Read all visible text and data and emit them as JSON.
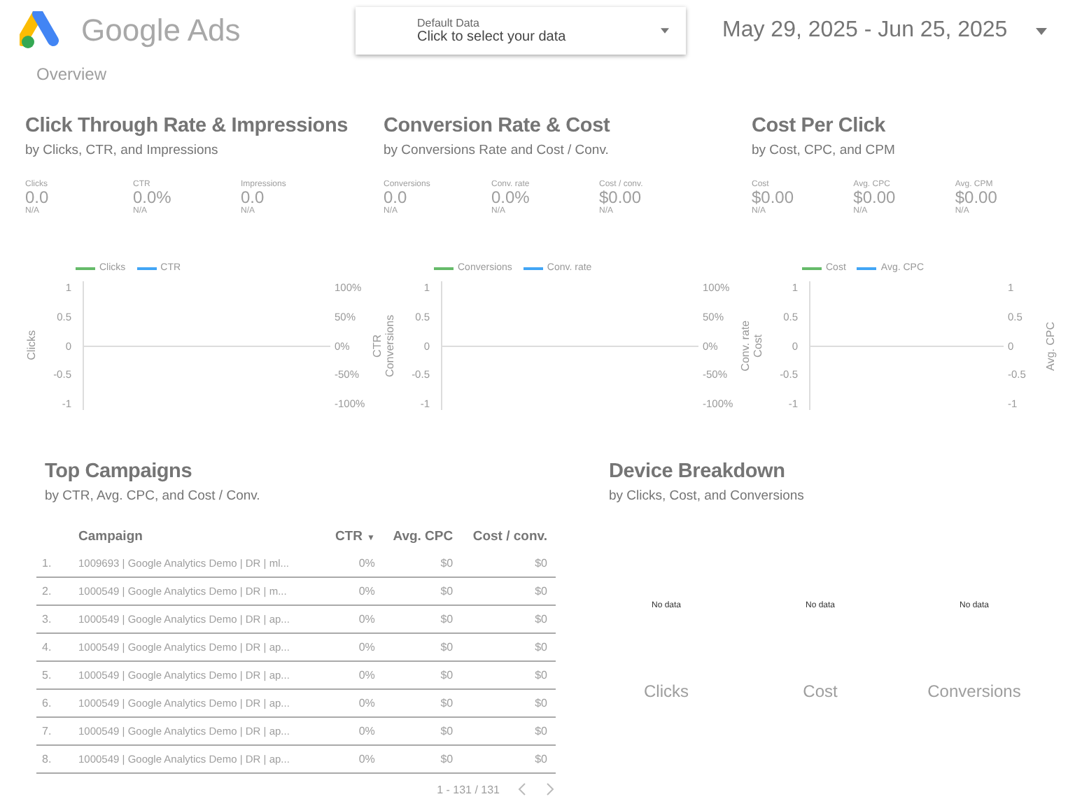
{
  "header": {
    "brand": "Google Ads",
    "data_source": {
      "label": "Default Data",
      "value": "Click to select your data"
    },
    "date_range": "May 29, 2025 - Jun 25, 2025"
  },
  "page_title": "Overview",
  "sections": [
    {
      "title": "Click Through Rate & Impressions",
      "subtitle": "by Clicks, CTR, and Impressions",
      "metrics": [
        {
          "label": "Clicks",
          "value": "0.0",
          "note": "N/A"
        },
        {
          "label": "CTR",
          "value": "0.0%",
          "note": "N/A"
        },
        {
          "label": "Impressions",
          "value": "0.0",
          "note": "N/A"
        }
      ],
      "chart": {
        "legend": [
          {
            "label": "Clicks",
            "color": "#66bb6a"
          },
          {
            "label": "CTR",
            "color": "#42a5f5"
          }
        ],
        "left_axis": {
          "title": "Clicks",
          "ticks": [
            "1",
            "0.5",
            "0",
            "-0.5",
            "-1"
          ]
        },
        "right_axis": {
          "title": "CTR",
          "ticks": [
            "100%",
            "50%",
            "0%",
            "-50%",
            "-100%"
          ]
        }
      }
    },
    {
      "title": "Conversion Rate & Cost",
      "subtitle": "by Conversions Rate and Cost / Conv.",
      "metrics": [
        {
          "label": "Conversions",
          "value": "0.0",
          "note": "N/A"
        },
        {
          "label": "Conv. rate",
          "value": "0.0%",
          "note": "N/A"
        },
        {
          "label": "Cost / conv.",
          "value": "$0.00",
          "note": "N/A"
        }
      ],
      "chart": {
        "legend": [
          {
            "label": "Conversions",
            "color": "#66bb6a"
          },
          {
            "label": "Conv. rate",
            "color": "#42a5f5"
          }
        ],
        "left_axis": {
          "title": "Conversions",
          "ticks": [
            "1",
            "0.5",
            "0",
            "-0.5",
            "-1"
          ]
        },
        "right_axis": {
          "title": "Conv. rate",
          "ticks": [
            "100%",
            "50%",
            "0%",
            "-50%",
            "-100%"
          ]
        }
      }
    },
    {
      "title": "Cost Per Click",
      "subtitle": "by Cost, CPC, and CPM",
      "metrics": [
        {
          "label": "Cost",
          "value": "$0.00",
          "note": "N/A"
        },
        {
          "label": "Avg. CPC",
          "value": "$0.00",
          "note": "N/A"
        },
        {
          "label": "Avg. CPM",
          "value": "$0.00",
          "note": "N/A"
        }
      ],
      "chart": {
        "legend": [
          {
            "label": "Cost",
            "color": "#66bb6a"
          },
          {
            "label": "Avg. CPC",
            "color": "#42a5f5"
          }
        ],
        "left_axis": {
          "title": "Cost",
          "ticks": [
            "1",
            "0.5",
            "0",
            "-0.5",
            "-1"
          ]
        },
        "right_axis": {
          "title": "Avg. CPC",
          "ticks": [
            "1",
            "0.5",
            "0",
            "-0.5",
            "-1"
          ]
        }
      }
    }
  ],
  "top_campaigns": {
    "title": "Top Campaigns",
    "subtitle": "by CTR, Avg. CPC, and Cost / Conv.",
    "columns": [
      {
        "label": "Campaign"
      },
      {
        "label": "CTR",
        "sort_indicator": "▼"
      },
      {
        "label": "Avg. CPC"
      },
      {
        "label": "Cost / conv."
      }
    ],
    "rows": [
      {
        "index": "1.",
        "campaign": "1009693 | Google Analytics Demo | DR | ml...",
        "ctr": "0%",
        "cpc": "$0",
        "cost_conv": "$0"
      },
      {
        "index": "2.",
        "campaign": "1000549 | Google Analytics Demo | DR | m...",
        "ctr": "0%",
        "cpc": "$0",
        "cost_conv": "$0"
      },
      {
        "index": "3.",
        "campaign": "1000549 | Google Analytics Demo | DR | ap...",
        "ctr": "0%",
        "cpc": "$0",
        "cost_conv": "$0"
      },
      {
        "index": "4.",
        "campaign": "1000549 | Google Analytics Demo | DR | ap...",
        "ctr": "0%",
        "cpc": "$0",
        "cost_conv": "$0"
      },
      {
        "index": "5.",
        "campaign": "1000549 | Google Analytics Demo | DR | ap...",
        "ctr": "0%",
        "cpc": "$0",
        "cost_conv": "$0"
      },
      {
        "index": "6.",
        "campaign": "1000549 | Google Analytics Demo | DR | ap...",
        "ctr": "0%",
        "cpc": "$0",
        "cost_conv": "$0"
      },
      {
        "index": "7.",
        "campaign": "1000549 | Google Analytics Demo | DR | ap...",
        "ctr": "0%",
        "cpc": "$0",
        "cost_conv": "$0"
      },
      {
        "index": "8.",
        "campaign": "1000549 | Google Analytics Demo | DR | ap...",
        "ctr": "0%",
        "cpc": "$0",
        "cost_conv": "$0"
      }
    ],
    "pagination": "1 - 131 / 131"
  },
  "device_breakdown": {
    "title": "Device Breakdown",
    "subtitle": "by Clicks, Cost, and Conversions",
    "panels": [
      {
        "message": "No data",
        "label": "Clicks"
      },
      {
        "message": "No data",
        "label": "Cost"
      },
      {
        "message": "No data",
        "label": "Conversions"
      }
    ]
  }
}
